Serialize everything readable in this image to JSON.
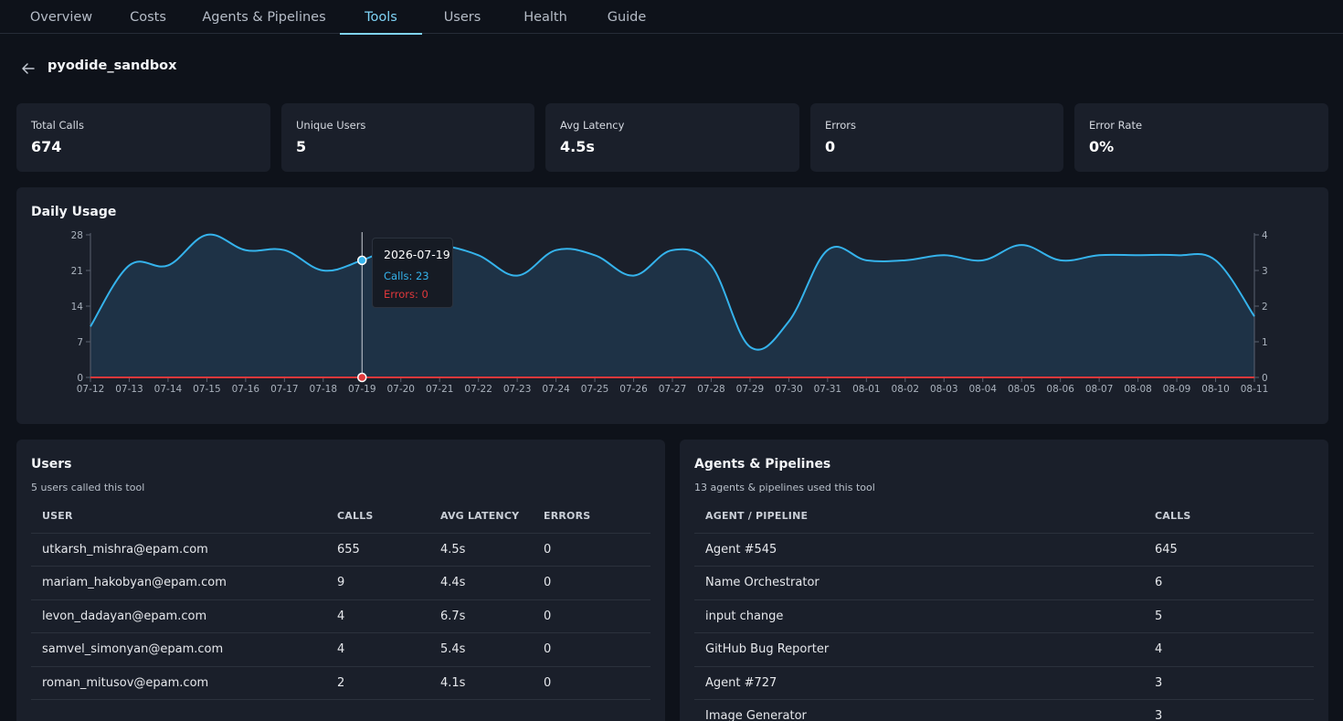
{
  "nav": {
    "tabs": [
      {
        "label": "Overview",
        "active": false
      },
      {
        "label": "Costs",
        "active": false
      },
      {
        "label": "Agents & Pipelines",
        "active": false
      },
      {
        "label": "Tools",
        "active": true
      },
      {
        "label": "Users",
        "active": false
      },
      {
        "label": "Health",
        "active": false
      },
      {
        "label": "Guide",
        "active": false
      }
    ]
  },
  "page": {
    "title": "pyodide_sandbox",
    "back_icon": "arrow-left-icon"
  },
  "kpis": [
    {
      "label": "Total Calls",
      "value": "674"
    },
    {
      "label": "Unique Users",
      "value": "5"
    },
    {
      "label": "Avg Latency",
      "value": "4.5s"
    },
    {
      "label": "Errors",
      "value": "0"
    },
    {
      "label": "Error Rate",
      "value": "0%"
    }
  ],
  "daily_usage": {
    "title": "Daily Usage",
    "tooltip": {
      "date": "2026-07-19",
      "calls": "Calls: 23",
      "errors": "Errors: 0"
    }
  },
  "chart_data": {
    "type": "area",
    "title": "Daily Usage",
    "x": [
      "07-12",
      "07-13",
      "07-14",
      "07-15",
      "07-16",
      "07-17",
      "07-18",
      "07-19",
      "07-20",
      "07-21",
      "07-22",
      "07-23",
      "07-24",
      "07-25",
      "07-26",
      "07-27",
      "07-28",
      "07-29",
      "07-30",
      "07-31",
      "08-01",
      "08-02",
      "08-03",
      "08-04",
      "08-05",
      "08-06",
      "08-07",
      "08-08",
      "08-09",
      "08-10",
      "08-11"
    ],
    "series": [
      {
        "name": "Calls",
        "axis": "left",
        "color": "#35b3ec",
        "values": [
          10,
          22,
          22,
          28,
          25,
          25,
          21,
          23,
          26,
          26,
          24,
          20,
          25,
          24,
          20,
          25,
          22,
          6,
          11,
          25,
          23,
          23,
          24,
          23,
          26,
          23,
          24,
          24,
          24,
          23,
          12
        ]
      },
      {
        "name": "Errors",
        "axis": "right",
        "color": "#e0383b",
        "values": [
          0,
          0,
          0,
          0,
          0,
          0,
          0,
          0,
          0,
          0,
          0,
          0,
          0,
          0,
          0,
          0,
          0,
          0,
          0,
          0,
          0,
          0,
          0,
          0,
          0,
          0,
          0,
          0,
          0,
          0,
          0
        ]
      }
    ],
    "y_left": {
      "ticks": [
        0,
        7,
        14,
        21,
        28
      ],
      "range": [
        0,
        28
      ]
    },
    "y_right": {
      "ticks": [
        0,
        1,
        2,
        3,
        4
      ],
      "range": [
        0,
        4
      ]
    },
    "highlight_index": 7
  },
  "users_section": {
    "title": "Users",
    "subtitle": "5 users called this tool",
    "columns": [
      "USER",
      "CALLS",
      "AVG LATENCY",
      "ERRORS"
    ],
    "rows": [
      [
        "utkarsh_mishra@epam.com",
        "655",
        "4.5s",
        "0"
      ],
      [
        "mariam_hakobyan@epam.com",
        "9",
        "4.4s",
        "0"
      ],
      [
        "levon_dadayan@epam.com",
        "4",
        "6.7s",
        "0"
      ],
      [
        "samvel_simonyan@epam.com",
        "4",
        "5.4s",
        "0"
      ],
      [
        "roman_mitusov@epam.com",
        "2",
        "4.1s",
        "0"
      ]
    ]
  },
  "agents_section": {
    "title": "Agents & Pipelines",
    "subtitle": "13 agents & pipelines used this tool",
    "columns": [
      "AGENT / PIPELINE",
      "CALLS"
    ],
    "rows": [
      [
        "Agent #545",
        "645"
      ],
      [
        "Name Orchestrator",
        "6"
      ],
      [
        "input change",
        "5"
      ],
      [
        "GitHub Bug Reporter",
        "4"
      ],
      [
        "Agent #727",
        "3"
      ],
      [
        "Image Generator",
        "3"
      ]
    ]
  }
}
